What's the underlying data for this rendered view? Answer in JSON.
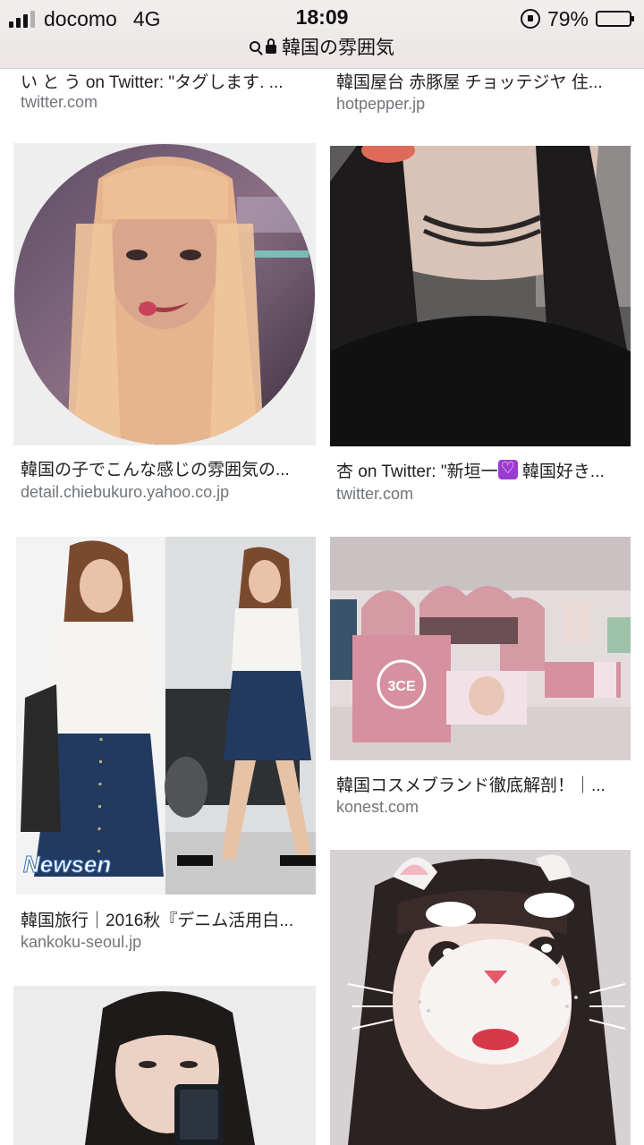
{
  "status_bar": {
    "carrier": "docomo",
    "network": "4G",
    "time": "18:09",
    "battery_percent": "79%",
    "battery_level": 0.79,
    "signal_bars": 3,
    "icons": [
      "signal-icon",
      "rotation-lock-icon",
      "battery-icon"
    ]
  },
  "url_bar": {
    "query": "韓国の雰囲気",
    "icons": [
      "search-icon",
      "lock-icon"
    ]
  },
  "results": [
    {
      "title": "い と う on Twitter: \"タグします. ...",
      "source": "twitter.com"
    },
    {
      "title": "韓国屋台 赤豚屋 チョッテジヤ 住...",
      "source": "hotpepper.jp"
    },
    {
      "title": "韓国の子でこんな感じの雰囲気の...",
      "source": "detail.chiebukuro.yahoo.co.jp",
      "image": "circle-portrait-blonde"
    },
    {
      "title_before": "杏 on Twitter: \"新垣一",
      "title_after": " 韓国好き...",
      "source": "twitter.com",
      "image": "portrait-choker"
    },
    {
      "title": "韓国旅行｜2016秋『デニム活用白...",
      "source": "kankoku-seoul.jp",
      "image": "denim-skirt-outfit",
      "watermark": "Newsen"
    },
    {
      "title": "韓国コスメブランド徹底解剖！｜...",
      "source": "konest.com",
      "image": "cosmetics-store-pink",
      "store_sign": "3CE"
    },
    {
      "title": "",
      "source": "",
      "image": "portrait-phone-selfie"
    },
    {
      "title": "",
      "source": "",
      "image": "bunny-filter-selfie"
    }
  ]
}
